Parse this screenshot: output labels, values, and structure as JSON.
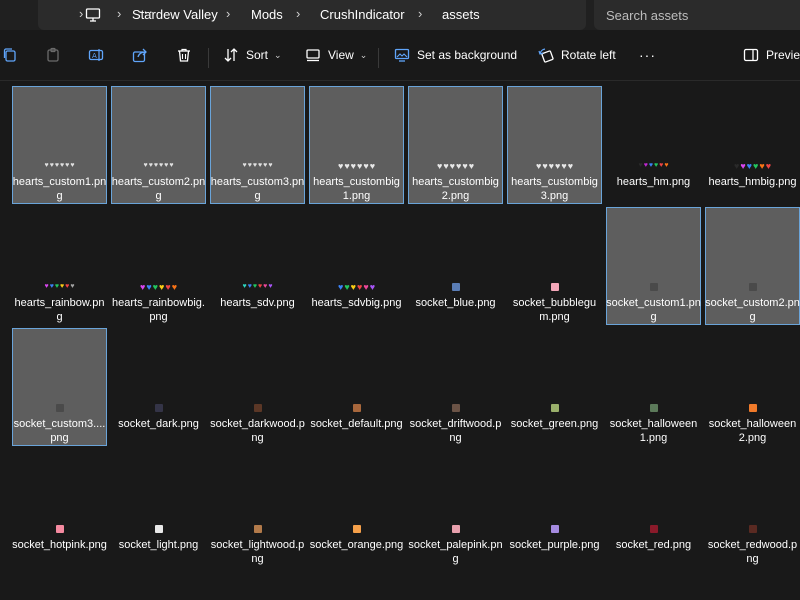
{
  "address_bar": {
    "more_label": "···",
    "breadcrumbs": [
      "Stardew Valley",
      "Mods",
      "CrushIndicator",
      "assets"
    ],
    "search_placeholder": "Search assets"
  },
  "toolbar": {
    "sort_label": "Sort",
    "view_label": "View",
    "set_background_label": "Set as background",
    "rotate_left_label": "Rotate left",
    "more_options_label": "···",
    "preview_label": "Preview"
  },
  "colors": {
    "accent": "#6aa4d9",
    "selected_bg": "#5e5e5e",
    "window_bg": "#191919"
  },
  "files": [
    {
      "name": "hearts_custom1.png",
      "selected": true,
      "thumb": "hearts",
      "colors": [
        "#e0e0e0",
        "#e0e0e0",
        "#e0e0e0",
        "#e0e0e0",
        "#e0e0e0",
        "#e0e0e0"
      ]
    },
    {
      "name": "hearts_custom2.png",
      "selected": true,
      "thumb": "hearts",
      "colors": [
        "#e0e0e0",
        "#e0e0e0",
        "#e0e0e0",
        "#e0e0e0",
        "#e0e0e0",
        "#e0e0e0"
      ]
    },
    {
      "name": "hearts_custom3.png",
      "selected": true,
      "thumb": "hearts",
      "colors": [
        "#e0e0e0",
        "#e0e0e0",
        "#e0e0e0",
        "#e0e0e0",
        "#e0e0e0",
        "#e0e0e0"
      ]
    },
    {
      "name": "hearts_custombig1.png",
      "selected": true,
      "thumb": "hearts_big",
      "colors": [
        "#e8e8e8",
        "#e8e8e8",
        "#e8e8e8",
        "#e8e8e8",
        "#e8e8e8",
        "#e8e8e8"
      ]
    },
    {
      "name": "hearts_custombig2.png",
      "selected": true,
      "thumb": "hearts_big",
      "colors": [
        "#e8e8e8",
        "#e8e8e8",
        "#e8e8e8",
        "#e8e8e8",
        "#e8e8e8",
        "#e8e8e8"
      ]
    },
    {
      "name": "hearts_custombig3.png",
      "selected": true,
      "thumb": "hearts_big",
      "colors": [
        "#e8e8e8",
        "#e8e8e8",
        "#e8e8e8",
        "#e8e8e8",
        "#e8e8e8",
        "#e8e8e8"
      ]
    },
    {
      "name": "hearts_hm.png",
      "selected": false,
      "thumb": "hearts",
      "colors": [
        "#2a2a2a",
        "#c026d3",
        "#3b82f6",
        "#22c55e",
        "#ef4444",
        "#f97316"
      ]
    },
    {
      "name": "hearts_hmbig.png",
      "selected": false,
      "thumb": "hearts_big",
      "colors": [
        "#2a2a2a",
        "#d946ef",
        "#3b82f6",
        "#22c55e",
        "#f97316",
        "#ef4444"
      ]
    },
    {
      "name": "hearts_rainbow.png",
      "selected": false,
      "thumb": "hearts",
      "colors": [
        "#d946ef",
        "#3b82f6",
        "#22c55e",
        "#facc15",
        "#ef4444",
        "#a3a3a3"
      ]
    },
    {
      "name": "hearts_rainbowbig.png",
      "selected": false,
      "thumb": "hearts_big",
      "colors": [
        "#d946ef",
        "#3b82f6",
        "#22c55e",
        "#facc15",
        "#ef4444",
        "#f97316"
      ]
    },
    {
      "name": "hearts_sdv.png",
      "selected": false,
      "thumb": "hearts",
      "colors": [
        "#2dd4bf",
        "#3b82f6",
        "#22c55e",
        "#ef4444",
        "#ec4899",
        "#a855f7"
      ]
    },
    {
      "name": "hearts_sdvbig.png",
      "selected": false,
      "thumb": "hearts_big",
      "colors": [
        "#3b82f6",
        "#22c55e",
        "#facc15",
        "#ef4444",
        "#ec4899",
        "#a855f7"
      ]
    },
    {
      "name": "socket_blue.png",
      "selected": false,
      "thumb": "square",
      "colors": [
        "#5a7db5"
      ]
    },
    {
      "name": "socket_bubblegum.png",
      "selected": false,
      "thumb": "square",
      "colors": [
        "#f4a7b9"
      ]
    },
    {
      "name": "socket_custom1.png",
      "selected": true,
      "thumb": "square",
      "colors": [
        "#4a4a4a"
      ]
    },
    {
      "name": "socket_custom2.png",
      "selected": true,
      "thumb": "square",
      "colors": [
        "#4a4a4a"
      ]
    },
    {
      "name": "socket_custom3....png",
      "selected": true,
      "thumb": "square",
      "colors": [
        "#4a4a4a"
      ]
    },
    {
      "name": "socket_dark.png",
      "selected": false,
      "thumb": "square",
      "colors": [
        "#343447"
      ]
    },
    {
      "name": "socket_darkwood.png",
      "selected": false,
      "thumb": "square",
      "colors": [
        "#5b3726"
      ]
    },
    {
      "name": "socket_default.png",
      "selected": false,
      "thumb": "square",
      "colors": [
        "#a8673c"
      ]
    },
    {
      "name": "socket_driftwood.png",
      "selected": false,
      "thumb": "square",
      "colors": [
        "#6b5346"
      ]
    },
    {
      "name": "socket_green.png",
      "selected": false,
      "thumb": "square",
      "colors": [
        "#9ab06b"
      ]
    },
    {
      "name": "socket_halloween1.png",
      "selected": false,
      "thumb": "square",
      "colors": [
        "#5c7a5a"
      ]
    },
    {
      "name": "socket_halloween2.png",
      "selected": false,
      "thumb": "square",
      "colors": [
        "#f07a2a"
      ]
    },
    {
      "name": "socket_hotpink.png",
      "selected": false,
      "thumb": "square",
      "colors": [
        "#f58aa0"
      ]
    },
    {
      "name": "socket_light.png",
      "selected": false,
      "thumb": "square",
      "colors": [
        "#e8e8e8"
      ]
    },
    {
      "name": "socket_lightwood.png",
      "selected": false,
      "thumb": "square",
      "colors": [
        "#b27a4a"
      ]
    },
    {
      "name": "socket_orange.png",
      "selected": false,
      "thumb": "square",
      "colors": [
        "#f5a04a"
      ]
    },
    {
      "name": "socket_palepink.png",
      "selected": false,
      "thumb": "square",
      "colors": [
        "#e8a0ad"
      ]
    },
    {
      "name": "socket_purple.png",
      "selected": false,
      "thumb": "square",
      "colors": [
        "#a58be0"
      ]
    },
    {
      "name": "socket_red.png",
      "selected": false,
      "thumb": "square",
      "colors": [
        "#8a1a2a"
      ]
    },
    {
      "name": "socket_redwood.png",
      "selected": false,
      "thumb": "square",
      "colors": [
        "#5a2a22"
      ]
    }
  ]
}
